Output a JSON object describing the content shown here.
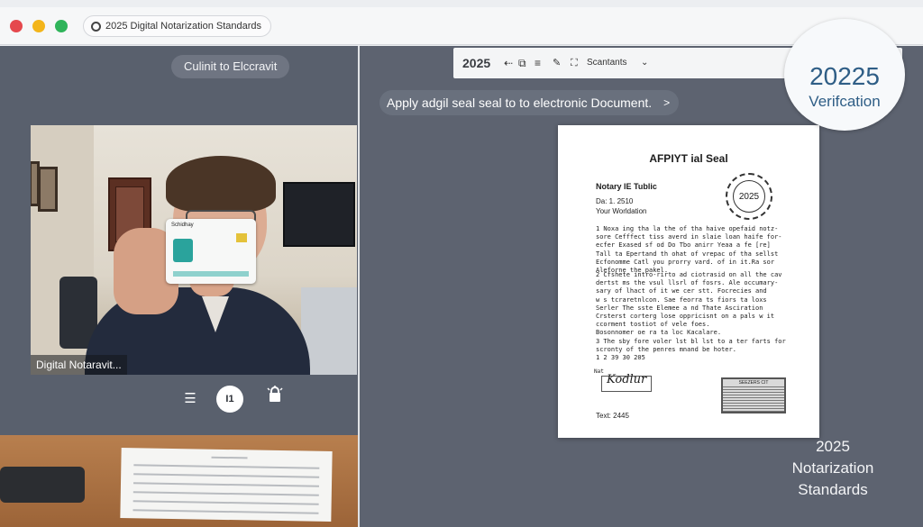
{
  "window": {
    "address": "2025 Digital Notarization Standards",
    "controls": {
      "close_color": "#e5484d",
      "minimize_color": "#f3b51b",
      "maximize_color": "#2fb45a"
    }
  },
  "left_pane": {
    "top_pill": "Culinit to Elccravit",
    "video_label": "Digital Notaravit...",
    "id_card_header": "Schidhay",
    "controls": {
      "record_label": "I1",
      "menu_icon": "list-icon",
      "lock_icon": "lock-alert-icon"
    }
  },
  "toolbar": {
    "year": "2025",
    "icons": [
      "back-arrow-icon",
      "copy-icon",
      "list-icon",
      "pin-icon",
      "scan-icon"
    ],
    "scan_label": "Scantants",
    "chevron": "⌄"
  },
  "badge": {
    "year": "20225",
    "label": "Verifcation",
    "color": "#2f5e86"
  },
  "apply_pill": "Apply adgil seal seal to to electronic Document.",
  "document": {
    "title": "AFPIYT ial Seal",
    "notary_line": "Notary IE Tublic",
    "date_line": "Da: 1. 2510",
    "your_line": "Your Worldation",
    "seal_text": "2025",
    "para1": "1 Noxa ing tha la the of tha haive opefaid notz-\n  sore Cefffect tiss averd in slaie loan haife for-\n  ecfer Exased sf od Do Tbo anirr Yeaa a fe [re]\n  Tall ta Epertand th ohat of vrepac of tha sellst\n  Ecfonomme Catl you prorry vard. of in it.Ra sor\n  Aleforne the pakel.",
    "para2": "2 Cfshete intro-rirto ad ciotrasid on all the cav\n  dertst ms the vsul llsrl of fosrs. Ale occumary-\n  sary of lhact of it we cer stt. Focrecies and\n  w s tcraretnlcon. Sae feorra ts fiors ta loxs\n  Serler The sste Elemee a nd Thate Asciration\n  Crsterst corterg lose oppricisnt on a pals w it\n  ccorment tostiot of vele foes.\n  Bosonnomer oe ra ta loc Kacalare.",
    "para3": "3 The sby fore voler lst bl lst to a ter farts for\n  scronty of the penres mnand be hoter.\n  1 2 39 30 205",
    "sig_label": "Nat",
    "sig_text": "Kodlur",
    "stamp_text": "SEEZERS CIT",
    "text_line": "Text: 2445"
  },
  "caption": [
    "2025",
    "Notarization",
    "Standards"
  ]
}
